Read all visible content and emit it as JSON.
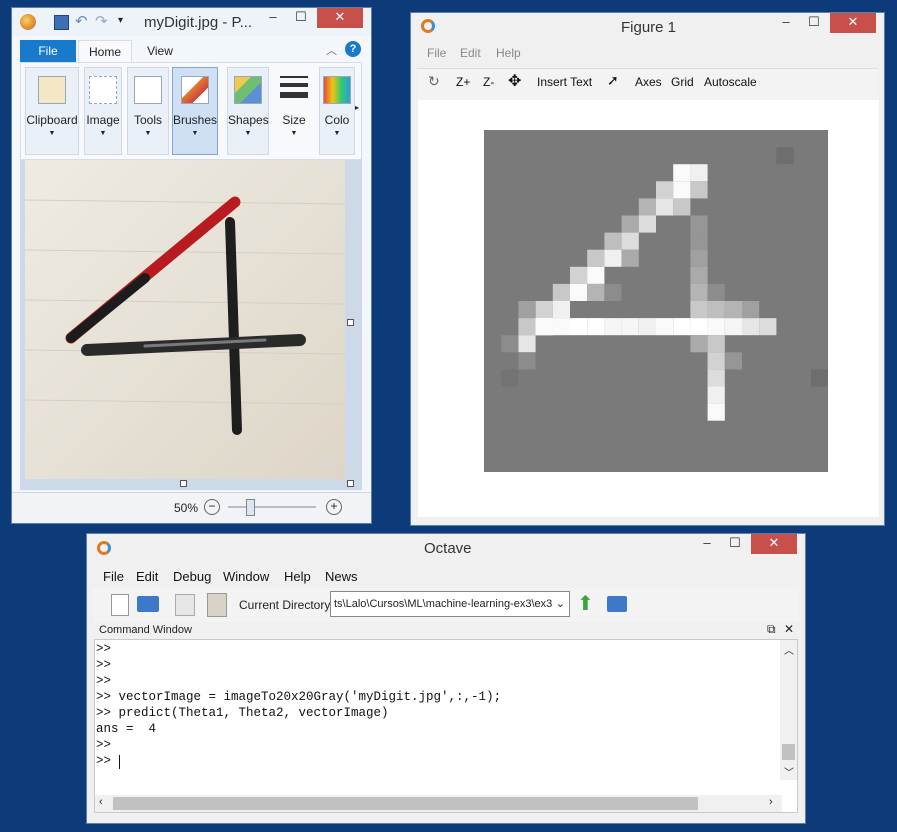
{
  "paint": {
    "title": "myDigit.jpg - P...",
    "tabs": [
      "File",
      "Home",
      "View"
    ],
    "groups": [
      "Clipboard",
      "Image",
      "Tools",
      "Brushes",
      "Shapes",
      "Size",
      "Colo"
    ],
    "zoom": "50%"
  },
  "figure": {
    "title": "Figure 1",
    "menu": [
      "File",
      "Edit",
      "Help"
    ],
    "toolbar": {
      "zoom_in": "Z+",
      "zoom_out": "Z-",
      "insert_text": "Insert Text",
      "axes": "Axes",
      "grid": "Grid",
      "autoscale": "Autoscale"
    },
    "colors": {
      "background": "#7a7a7a",
      "stroke": "#ffffff"
    }
  },
  "octave": {
    "title": "Octave",
    "menu": [
      "File",
      "Edit",
      "Debug",
      "Window",
      "Help",
      "News"
    ],
    "current_directory_label": "Current Directory:",
    "current_directory_value": "ts\\Lalo\\Cursos\\ML\\machine-learning-ex3\\ex3",
    "command_window_title": "Command Window",
    "lines": [
      ">>",
      ">>",
      ">>",
      ">> vectorImage = imageTo20x20Gray('myDigit.jpg',:,-1);",
      ">> predict(Theta1, Theta2, vectorImage)",
      "ans =  4",
      ">>",
      ">> "
    ]
  }
}
